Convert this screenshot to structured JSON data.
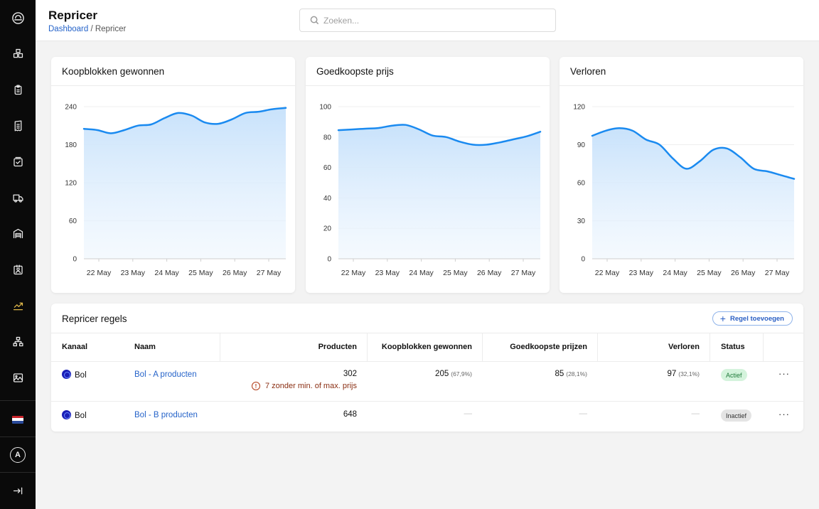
{
  "header": {
    "title": "Repricer",
    "breadcrumb_home": "Dashboard",
    "breadcrumb_sep": " / ",
    "breadcrumb_current": "Repricer",
    "search_placeholder": "Zoeken..."
  },
  "sidebar": {
    "items": [
      "logo-icon",
      "boxes-icon",
      "clipboard-icon",
      "receipt-icon",
      "package-check-icon",
      "truck-icon",
      "warehouse-icon",
      "contact-card-icon",
      "chart-trend-icon",
      "sitemap-icon",
      "image-icon"
    ],
    "active_item": "chart-trend-icon",
    "flag": "nl-flag-icon",
    "avatar_initial": "A",
    "logout_icon": "logout-icon"
  },
  "charts": [
    {
      "title": "Koopblokken gewonnen",
      "chart_data": {
        "type": "area",
        "categories": [
          "22 May",
          "23 May",
          "24 May",
          "25 May",
          "26 May",
          "27 May"
        ],
        "points": [
          205,
          203,
          198,
          203,
          210,
          212,
          222,
          230,
          226,
          215,
          213,
          220,
          230,
          232,
          236,
          238
        ],
        "yticks": [
          0,
          60,
          120,
          180,
          240
        ],
        "ylim": [
          0,
          240
        ],
        "color": "#1a8af0"
      }
    },
    {
      "title": "Goedkoopste prijs",
      "chart_data": {
        "type": "area",
        "categories": [
          "22 May",
          "23 May",
          "24 May",
          "25 May",
          "26 May",
          "27 May"
        ],
        "points": [
          84.5,
          85,
          85.5,
          86,
          87.5,
          88,
          85,
          81,
          80,
          77,
          75,
          75,
          76.5,
          78.5,
          80.5,
          83.5
        ],
        "yticks": [
          0,
          20,
          40,
          60,
          80,
          100
        ],
        "ylim": [
          0,
          100
        ],
        "color": "#1a8af0"
      }
    },
    {
      "title": "Verloren",
      "chart_data": {
        "type": "area",
        "categories": [
          "22 May",
          "23 May",
          "24 May",
          "25 May",
          "26 May",
          "27 May"
        ],
        "points": [
          97,
          101,
          103,
          101,
          94,
          90,
          79,
          71,
          77,
          86,
          87,
          80,
          71,
          69,
          66,
          63
        ],
        "yticks": [
          0,
          30,
          60,
          90,
          120
        ],
        "ylim": [
          0,
          120
        ],
        "color": "#1a8af0"
      }
    }
  ],
  "table": {
    "title": "Repricer regels",
    "add_button": "Regel toevoegen",
    "columns": [
      "Kanaal",
      "Naam",
      "Producten",
      "Koopblokken gewonnen",
      "Goedkoopste prijzen",
      "Verloren",
      "Status"
    ],
    "rows": [
      {
        "kanaal": "Bol",
        "naam": "Bol - A producten",
        "producten": "302",
        "warning": "7 zonder min. of max. prijs",
        "koopblokken": "205",
        "koopblokken_pct": "(67,9%)",
        "goedkoopste": "85",
        "goedkoopste_pct": "(28,1%)",
        "verloren": "97",
        "verloren_pct": "(32,1%)",
        "status": "Actief",
        "more": "···"
      },
      {
        "kanaal": "Bol",
        "naam": "Bol - B producten",
        "producten": "648",
        "koopblokken": "—",
        "goedkoopste": "—",
        "verloren": "—",
        "status": "Inactief",
        "more": "···"
      }
    ]
  }
}
